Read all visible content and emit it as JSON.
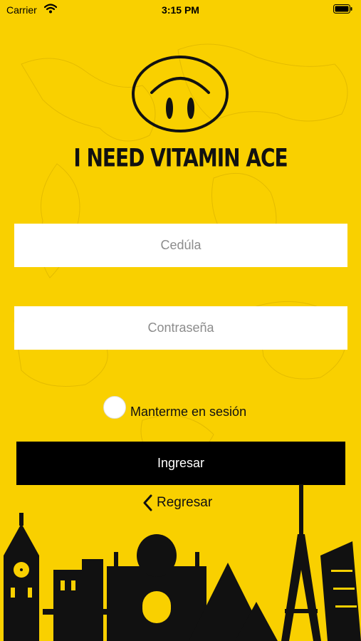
{
  "status": {
    "carrier": "Carrier",
    "time": "3:15 PM"
  },
  "brand": {
    "name": "I NEED VITAMIN ACE"
  },
  "form": {
    "cedula_placeholder": "Cedúla",
    "password_placeholder": "Contraseña",
    "remember_label": "Manterme en sesión",
    "submit_label": "Ingresar",
    "back_label": "Regresar"
  },
  "colors": {
    "background": "#F9D000",
    "button": "#000000",
    "field": "#FFFFFF"
  }
}
